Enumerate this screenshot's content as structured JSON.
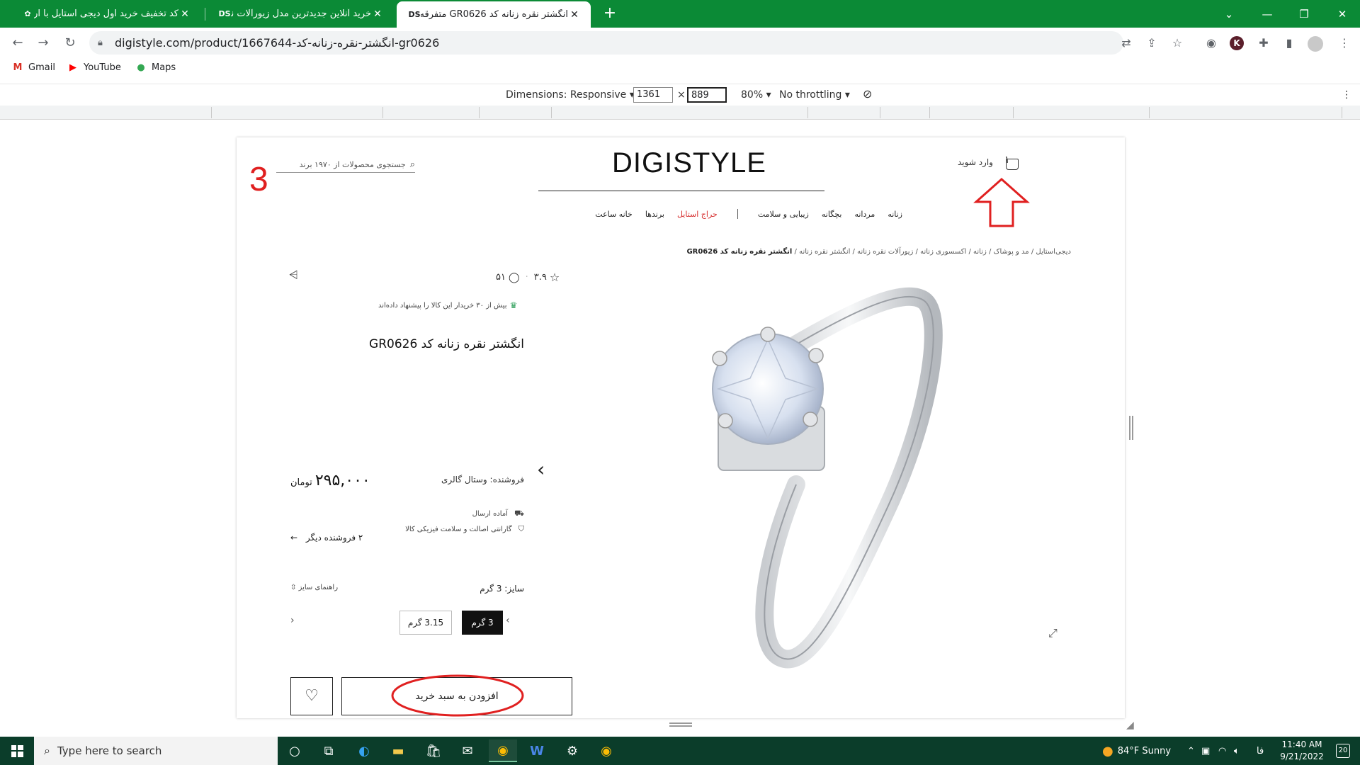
{
  "browser": {
    "tabs": [
      {
        "title": "کد تخفیف خرید اول دیجی استایل با ار...",
        "active": false
      },
      {
        "title": "خرید آنلاین جدیدترین مدل زیورآلات نقر...",
        "active": false,
        "favicon": "DS"
      },
      {
        "title": "انگشتر نقره زنانه کد GR0626 متفرقه | ...",
        "active": true,
        "favicon": "DS"
      }
    ],
    "url": "digistyle.com/product/1667644-انگشتر-نقره-زنانه-کد-gr0626",
    "bookmarks": [
      "Gmail",
      "YouTube",
      "Maps"
    ],
    "profile_initial": "K"
  },
  "devtools": {
    "dimensions_label": "Dimensions: Responsive",
    "width": "1361",
    "height": "889",
    "zoom": "80%",
    "throttling": "No throttling"
  },
  "site": {
    "logo": "DIGISTYLE",
    "search_placeholder": "جستجوی محصولات از ۱۹۷۰ برند",
    "login": "وارد شوید",
    "cart_count": "۱",
    "nav": [
      "زنانه",
      "مردانه",
      "بچگانه",
      "زیبایی و سلامت",
      "حراج استایل",
      "برندها",
      "خانه ساعت"
    ],
    "breadcrumb": "دیجی‌استایل / مد و پوشاک / زنانه / اکسسوری زنانه / زیورآلات نقره زنانه / انگشتر نقره زنانه /",
    "breadcrumb_current": "انگشتر نقره زنانه کد GR0626"
  },
  "product": {
    "title": "انگشتر نقره زنانه کد GR0626",
    "rating": "۳.۹",
    "comments": "۵۱",
    "recommend": "بیش از ۳۰ خریدار این کالا را پیشنهاد داده‌اند",
    "price": "۲۹۵,۰۰۰",
    "currency": "تومان",
    "seller": "فروشنده: وستال گالری",
    "features": [
      "آماده ارسال",
      "گارانتی اصالت و سلامت فیزیکی کالا"
    ],
    "other_sellers": "۲ فروشنده دیگر",
    "size_label": "سایز: 3 گرم",
    "size_guide": "راهنمای سایز",
    "sizes": [
      {
        "label": "3 گرم",
        "selected": true
      },
      {
        "label": "3.15 گرم",
        "selected": false
      }
    ],
    "add_to_cart": "افزودن به سبد خرید"
  },
  "annotations": {
    "step_number": "3",
    "color": "#e02020"
  },
  "taskbar": {
    "search_placeholder": "Type here to search",
    "weather": "84°F  Sunny",
    "language": "فا",
    "time": "11:40 AM",
    "date": "9/21/2022",
    "notifications": "20"
  },
  "colors": {
    "browser_frame": "#0b8a36",
    "taskbar": "#0b3d2a",
    "sale": "#d62d2d",
    "annotation_red": "#e02020"
  }
}
